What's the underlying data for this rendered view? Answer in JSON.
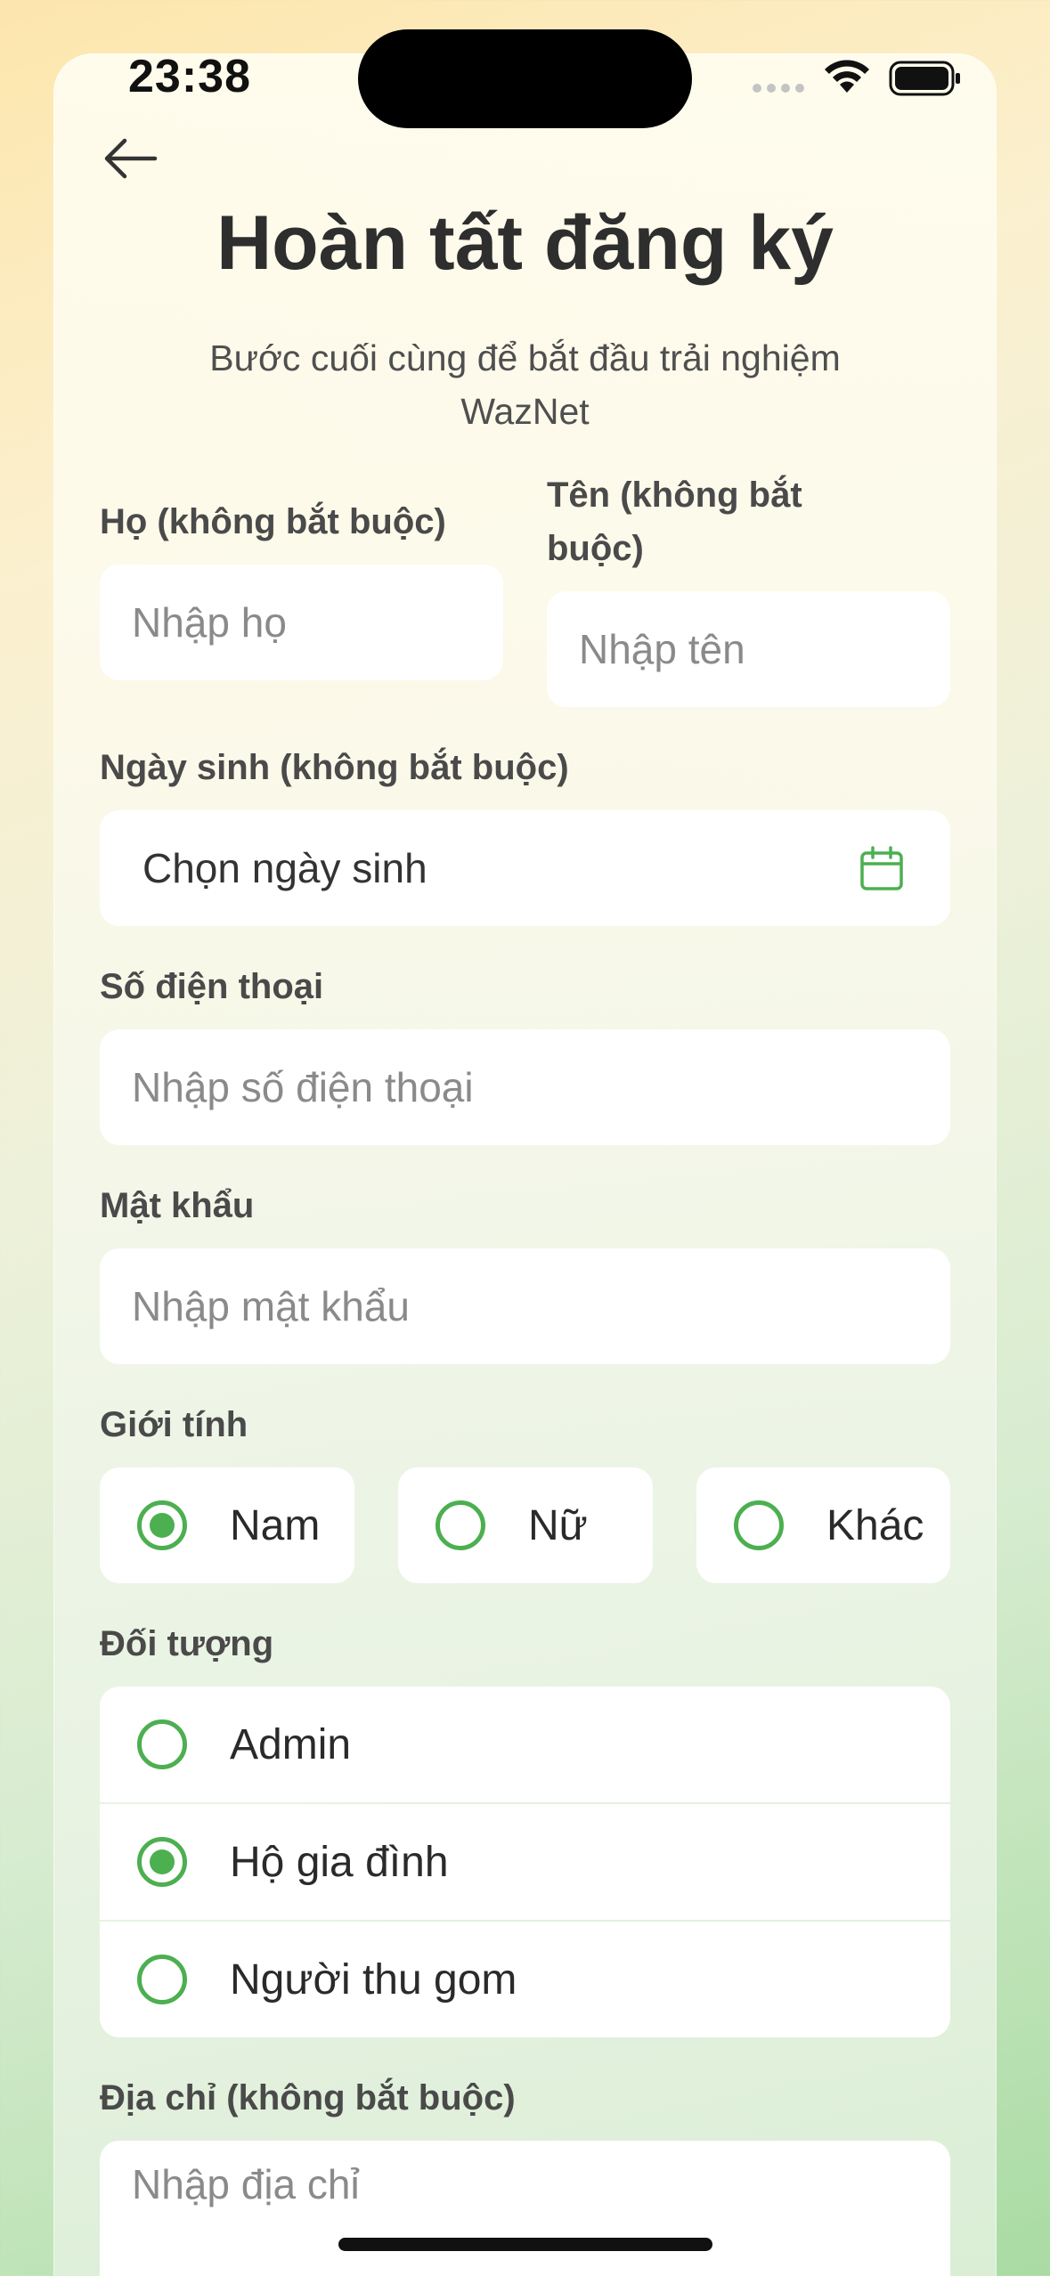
{
  "status_bar": {
    "time": "23:38"
  },
  "header": {
    "title": "Hoàn tất đăng ký",
    "subtitle": "Bước cuối cùng để bắt đầu trải nghiệm WazNet"
  },
  "form": {
    "last_name": {
      "label": "Họ (không bắt buộc)",
      "placeholder": "Nhập họ"
    },
    "first_name": {
      "label": "Tên (không bắt buộc)",
      "placeholder": "Nhập tên"
    },
    "birthday": {
      "label": "Ngày sinh (không bắt buộc)",
      "value": "Chọn ngày sinh"
    },
    "phone": {
      "label": "Số điện thoại",
      "placeholder": "Nhập số điện thoại"
    },
    "password": {
      "label": "Mật khẩu",
      "placeholder": "Nhập mật khẩu"
    },
    "gender": {
      "label": "Giới tính",
      "options": [
        "Nam",
        "Nữ",
        "Khác"
      ],
      "selected": "Nam"
    },
    "role": {
      "label": "Đối tượng",
      "options": [
        "Admin",
        "Hộ gia đình",
        "Người thu gom"
      ],
      "selected": "Hộ gia đình"
    },
    "address": {
      "label": "Địa chỉ (không bắt buộc)",
      "placeholder": "Nhập địa chỉ"
    }
  },
  "colors": {
    "accent": "#4caf50"
  },
  "icons": [
    "back-arrow-icon",
    "calendar-icon",
    "wifi-icon",
    "battery-icon"
  ]
}
